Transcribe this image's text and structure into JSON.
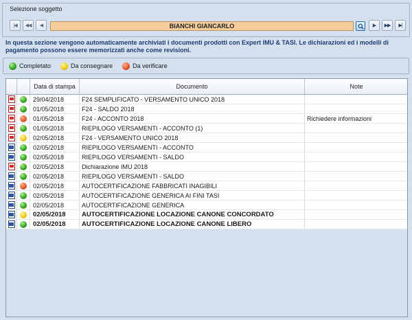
{
  "soggetto": {
    "group_title": "Selezione soggetto",
    "name": "BIANCHI GIANCARLO"
  },
  "info": {
    "text": "In questa sezione vengono automaticamente archiviati i documenti prodotti con Expert IMU & TASI. Le dichiarazioni ed i modelli di pagamento possono essere memorizzati anche come revisioni."
  },
  "legend": {
    "completed": "Completato",
    "to_deliver": "Da consegnare",
    "to_verify": "Da verificare"
  },
  "colors": {
    "completed": "#2ea21a",
    "to_deliver": "#f2c807",
    "to_verify": "#e4532a",
    "subject_bar": "#f5cc9a"
  },
  "grid": {
    "headers": {
      "date": "Data di stampa",
      "document": "Documento",
      "notes": "Note"
    },
    "rows": [
      {
        "file": "pdf",
        "state": "green",
        "date": "29/04/2018",
        "doc": "F24 SEMPLIFICATO - VERSAMENTO UNICO 2018",
        "note": "",
        "bold": false
      },
      {
        "file": "pdf",
        "state": "green",
        "date": "01/05/2018",
        "doc": "F24 - SALDO 2018",
        "note": "",
        "bold": false
      },
      {
        "file": "pdf",
        "state": "red",
        "date": "01/05/2018",
        "doc": "F24 - ACCONTO 2018",
        "note": "Richiedere informazioni",
        "bold": false
      },
      {
        "file": "pdf",
        "state": "green",
        "date": "01/05/2018",
        "doc": "RIEPILOGO VERSAMENTI - ACCONTO (1)",
        "note": "",
        "bold": false
      },
      {
        "file": "pdf",
        "state": "yellow",
        "date": "02/05/2018",
        "doc": "F24 - VERSAMENTO UNICO 2018",
        "note": "",
        "bold": false
      },
      {
        "file": "word",
        "state": "green",
        "date": "02/05/2018",
        "doc": "RIEPILOGO VERSAMENTI - ACCONTO",
        "note": "",
        "bold": false
      },
      {
        "file": "word",
        "state": "green",
        "date": "02/05/2018",
        "doc": "RIEPILOGO VERSAMENTI - SALDO",
        "note": "",
        "bold": false
      },
      {
        "file": "pdf",
        "state": "green",
        "date": "02/05/2018",
        "doc": "Dichiarazione IMU 2018",
        "note": "",
        "bold": false
      },
      {
        "file": "word",
        "state": "green",
        "date": "02/05/2018",
        "doc": "RIEPILOGO VERSAMENTI - SALDO",
        "note": "",
        "bold": false
      },
      {
        "file": "word",
        "state": "red",
        "date": "02/05/2018",
        "doc": "AUTOCERTIFICAZIONE FABBRICATI INAGIBILI",
        "note": "",
        "bold": false
      },
      {
        "file": "word",
        "state": "green",
        "date": "02/05/2018",
        "doc": "AUTOCERTIFICAZIONE GENERICA AI FINI TASI",
        "note": "",
        "bold": false
      },
      {
        "file": "word",
        "state": "green",
        "date": "02/05/2018",
        "doc": "AUTOCERTIFICAZIONE GENERICA",
        "note": "",
        "bold": false
      },
      {
        "file": "word",
        "state": "yellow",
        "date": "02/05/2018",
        "doc": "AUTOCERTIFICAZIONE LOCAZIONE CANONE CONCORDATO",
        "note": "",
        "bold": true
      },
      {
        "file": "word",
        "state": "green",
        "date": "02/05/2018",
        "doc": "AUTOCERTIFICAZIONE LOCAZIONE CANONE LIBERO",
        "note": "",
        "bold": true
      }
    ]
  }
}
